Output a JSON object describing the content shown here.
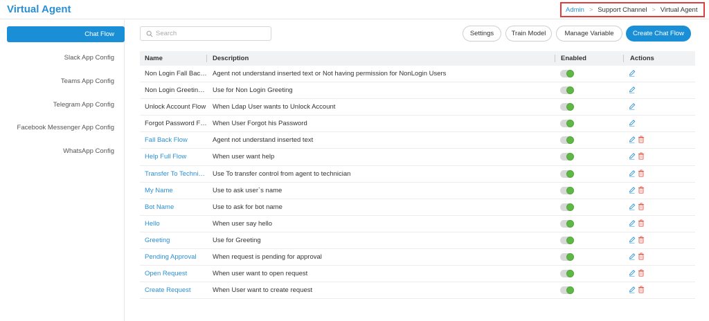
{
  "page": {
    "title": "Virtual Agent"
  },
  "breadcrumb": {
    "items": [
      "Admin",
      "Support Channel",
      "Virtual Agent"
    ]
  },
  "sidebar": {
    "items": [
      {
        "label": "Chat Flow",
        "active": true
      },
      {
        "label": "Slack App Config"
      },
      {
        "label": "Teams App Config"
      },
      {
        "label": "Telegram App Config"
      },
      {
        "label": "Facebook Messenger App Config"
      },
      {
        "label": "WhatsApp Config"
      }
    ]
  },
  "search": {
    "placeholder": "Search",
    "value": ""
  },
  "toolbar": {
    "settings_label": "Settings",
    "train_label": "Train Model",
    "manage_variable_label": "Manage Variable",
    "create_label": "Create Chat Flow"
  },
  "table": {
    "headers": {
      "name": "Name",
      "description": "Description",
      "enabled": "Enabled",
      "actions": "Actions"
    },
    "rows": [
      {
        "name": "Non Login Fall Back ...",
        "description": "Agent not understand inserted text or Not having permission for NonLogin Users",
        "enabled": true,
        "deletable": false,
        "link": false
      },
      {
        "name": "Non Login Greeting ...",
        "description": "Use for Non Login Greeting",
        "enabled": true,
        "deletable": false,
        "link": false
      },
      {
        "name": "Unlock Account Flow",
        "description": "When Ldap User wants to Unlock Account",
        "enabled": true,
        "deletable": false,
        "link": false
      },
      {
        "name": "Forgot Password Fl...",
        "description": "When User Forgot his Password",
        "enabled": true,
        "deletable": false,
        "link": false
      },
      {
        "name": "Fall Back Flow",
        "description": "Agent not understand inserted text",
        "enabled": true,
        "deletable": true,
        "link": true
      },
      {
        "name": "Help Full Flow",
        "description": "When user want help",
        "enabled": true,
        "deletable": true,
        "link": true
      },
      {
        "name": "Transfer To Technic...",
        "description": "Use To transfer control from agent to technician",
        "enabled": true,
        "deletable": true,
        "link": true
      },
      {
        "name": "My Name",
        "description": "Use to ask user`s name",
        "enabled": true,
        "deletable": true,
        "link": true
      },
      {
        "name": "Bot Name",
        "description": "Use to ask for bot name",
        "enabled": true,
        "deletable": true,
        "link": true
      },
      {
        "name": "Hello",
        "description": "When user say hello",
        "enabled": true,
        "deletable": true,
        "link": true
      },
      {
        "name": "Greeting",
        "description": "Use for Greeting",
        "enabled": true,
        "deletable": true,
        "link": true
      },
      {
        "name": "Pending Approval",
        "description": "When request is pending for approval",
        "enabled": true,
        "deletable": true,
        "link": true
      },
      {
        "name": "Open Request",
        "description": "When user want to open request",
        "enabled": true,
        "deletable": true,
        "link": true
      },
      {
        "name": "Create Request",
        "description": "When User want to create request",
        "enabled": true,
        "deletable": true,
        "link": true
      }
    ]
  },
  "colors": {
    "accent": "#1b8fd6",
    "link": "#2a8fd4",
    "toggle_on": "#5fb845",
    "delete": "#e05a4a",
    "breadcrumb_border": "#e33b3b"
  },
  "icons": {
    "search": "search-icon",
    "edit": "pencil-icon",
    "delete": "trash-icon",
    "separator": "chevron-right-icon"
  }
}
